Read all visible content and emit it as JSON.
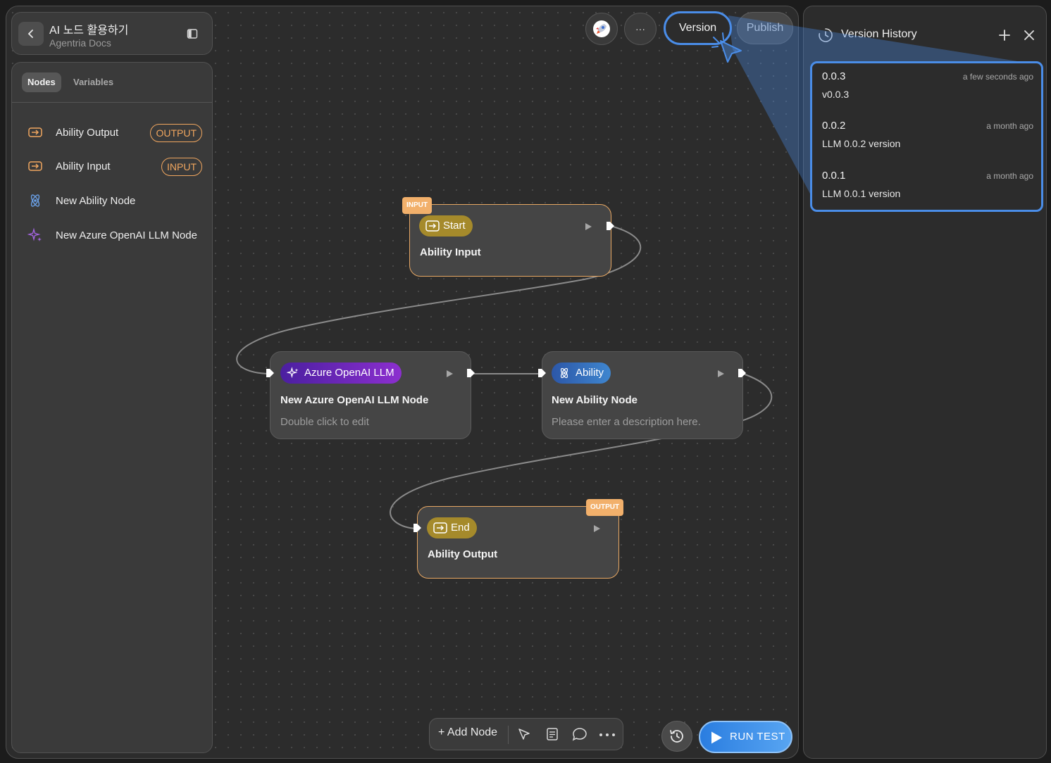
{
  "header": {
    "title": "AI 노드 활용하기",
    "subtitle": "Agentria Docs"
  },
  "sidebar": {
    "tabs": [
      {
        "label": "Nodes",
        "active": true
      },
      {
        "label": "Variables",
        "active": false
      }
    ],
    "items": [
      {
        "label": "Ability Output",
        "badge": "OUTPUT",
        "icon": "io-arrow-icon"
      },
      {
        "label": "Ability Input",
        "badge": "INPUT",
        "icon": "io-arrow-icon"
      },
      {
        "label": "New Ability Node",
        "badge": "",
        "icon": "atom-icon"
      },
      {
        "label": "New Azure OpenAI LLM Node",
        "badge": "",
        "icon": "sparkle-icon"
      }
    ]
  },
  "top_actions": {
    "more_label": "···",
    "version_label": "Version",
    "publish_label": "Publish"
  },
  "flow": {
    "start": {
      "tag": "INPUT",
      "pill": "Start",
      "title": "Ability Input"
    },
    "llm": {
      "pill": "Azure OpenAI LLM",
      "title": "New Azure OpenAI LLM Node",
      "desc": "Double click to edit"
    },
    "ability": {
      "pill": "Ability",
      "title": "New Ability Node",
      "desc": "Please enter a description here."
    },
    "end": {
      "tag": "OUTPUT",
      "pill": "End",
      "title": "Ability Output"
    }
  },
  "toolbar": {
    "add_node_label": "+ Add Node",
    "run_test_label": "RUN TEST"
  },
  "version_history": {
    "title": "Version History",
    "versions": [
      {
        "version": "0.0.3",
        "time": "a few seconds ago",
        "note": "v0.0.3"
      },
      {
        "version": "0.0.2",
        "time": "a month ago",
        "note": "LLM 0.0.2 version"
      },
      {
        "version": "0.0.1",
        "time": "a month ago",
        "note": "LLM 0.0.1 version"
      }
    ]
  },
  "colors": {
    "accent_blue": "#4a8de8",
    "io_orange": "#f0a65f",
    "start_end_gold": "#a58a2b",
    "llm_purple": "#8c2fcf",
    "ability_blue": "#3f86cf"
  }
}
